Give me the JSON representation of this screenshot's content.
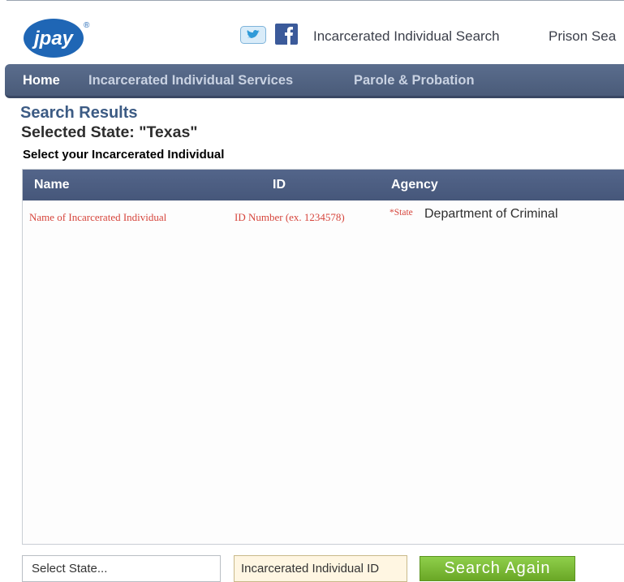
{
  "header": {
    "logo_text": "jpay",
    "logo_reg": "®",
    "links": [
      "Incarcerated Individual Search",
      "Prison Sea"
    ]
  },
  "nav": {
    "items": [
      "Home",
      "Incarcerated Individual Services",
      "Parole & Probation"
    ]
  },
  "results": {
    "title": "Search Results",
    "selected_state": "Selected State: \"Texas\"",
    "instruction": "Select your Incarcerated Individual",
    "columns": [
      "Name",
      "ID",
      "Agency"
    ],
    "row": {
      "name": "Name of Incarcerated Individual",
      "id": "ID Number (ex. 1234578)",
      "state_prefix": "*State",
      "agency": "Department of Criminal"
    }
  },
  "search": {
    "state_placeholder": "Select State...",
    "id_placeholder": "Incarcerated Individual ID",
    "button_label": "Search Again"
  },
  "icons": {
    "twitter": "twitter-icon",
    "facebook": "facebook-icon"
  },
  "colors": {
    "nav_bg": "#4f6083",
    "title_blue": "#3c5b84",
    "placeholder_red": "#d6453c",
    "button_green": "#7bbb36",
    "logo_blue": "#1f66b5"
  }
}
